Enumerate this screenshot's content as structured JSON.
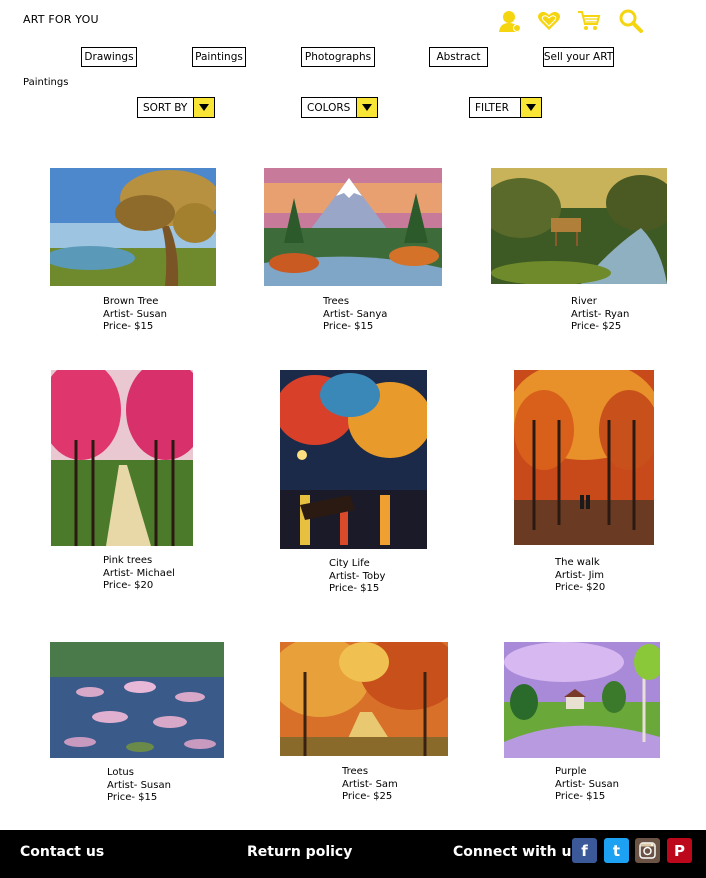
{
  "brand": "ART FOR YOU",
  "header_icons": [
    "user-icon",
    "heart-icon",
    "cart-icon",
    "search-icon"
  ],
  "categories": [
    "Drawings",
    "Paintings",
    "Photographs",
    "Abstract",
    "Sell your ART"
  ],
  "section_label": "Paintings",
  "dropdowns": {
    "sort_by": "SORT BY",
    "colors": "COLORS",
    "filter": "FILTER"
  },
  "products": [
    {
      "title": "Brown Tree",
      "artist": "Artist- Susan",
      "price": "Price- $15"
    },
    {
      "title": "Trees",
      "artist": "Artist- Sanya",
      "price": "Price- $15"
    },
    {
      "title": "River",
      "artist": "Artist- Ryan",
      "price": "Price- $25"
    },
    {
      "title": "Pink trees",
      "artist": "Artist- Michael",
      "price": "Price- $20"
    },
    {
      "title": "City Life",
      "artist": "Artist- Toby",
      "price": "Price- $15"
    },
    {
      "title": "The walk",
      "artist": "Artist- Jim",
      "price": "Price- $20"
    },
    {
      "title": "Lotus",
      "artist": "Artist- Susan",
      "price": "Price- $15"
    },
    {
      "title": "Trees",
      "artist": "Artist- Sam",
      "price": "Price- $25"
    },
    {
      "title": "Purple",
      "artist": "Artist- Susan",
      "price": "Price- $15"
    }
  ],
  "footer": {
    "contact": "Contact us",
    "return_policy": "Return policy",
    "connect": "Connect with us :",
    "social": {
      "facebook": "f",
      "twitter": "t",
      "pinterest": "P"
    }
  },
  "colors": {
    "accent_yellow": "#f8e535",
    "icon_gold": "#f5d50f",
    "footer_bg": "#000000",
    "facebook": "#3b5998",
    "twitter": "#1da1f2",
    "instagram": "#6b5446",
    "pinterest": "#bd081c"
  }
}
